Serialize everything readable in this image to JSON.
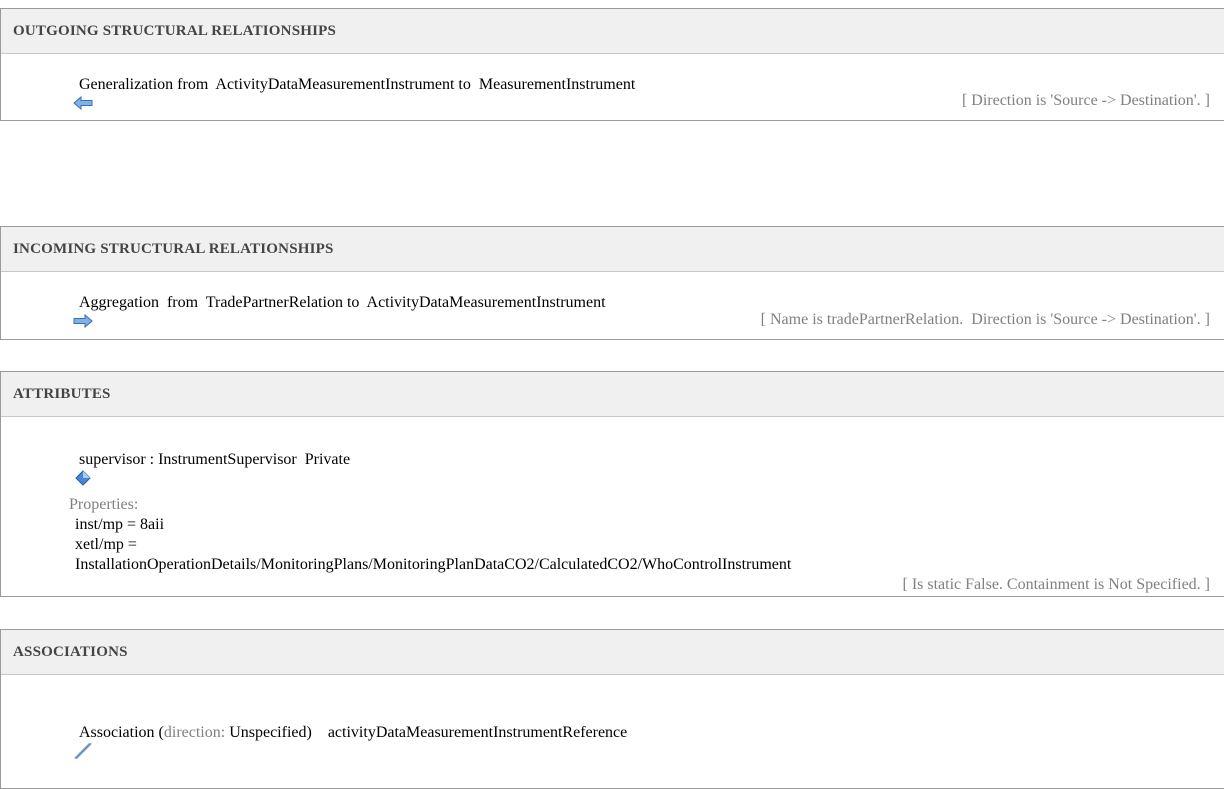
{
  "outgoing": {
    "header": "OUTGOING STRUCTURAL RELATIONSHIPS",
    "relation": "Generalization from  ActivityDataMeasurementInstrument to  MeasurementInstrument",
    "note": "[ Direction is 'Source -> Destination'. ]",
    "icon": "arrow-left-icon"
  },
  "incoming": {
    "header": "INCOMING STRUCTURAL RELATIONSHIPS",
    "relation": "Aggregation  from  TradePartnerRelation to  ActivityDataMeasurementInstrument",
    "note": "[ Name is tradePartnerRelation.  Direction is 'Source -> Destination'. ]",
    "icon": "arrow-right-icon"
  },
  "attributes": {
    "header": "ATTRIBUTES",
    "attribute": "supervisor : InstrumentSupervisor  Private",
    "properties_label": "Properties:",
    "prop1": "inst/mp = 8aii",
    "prop2": "xetl/mp =",
    "prop3": "InstallationOperationDetails/MonitoringPlans/MonitoringPlanDataCO2/CalculatedCO2/WhoControlInstrument",
    "note": "[ Is static False. Containment is Not Specified. ]",
    "icon": "attribute-diamond-icon"
  },
  "associations": {
    "header": "ASSOCIATIONS",
    "assoc_prefix": "Association (",
    "assoc_direction_label": "direction: ",
    "assoc_direction_value": "Unspecified)",
    "assoc_name": "    activityDataMeasurementInstrumentReference",
    "icon": "association-line-icon"
  }
}
